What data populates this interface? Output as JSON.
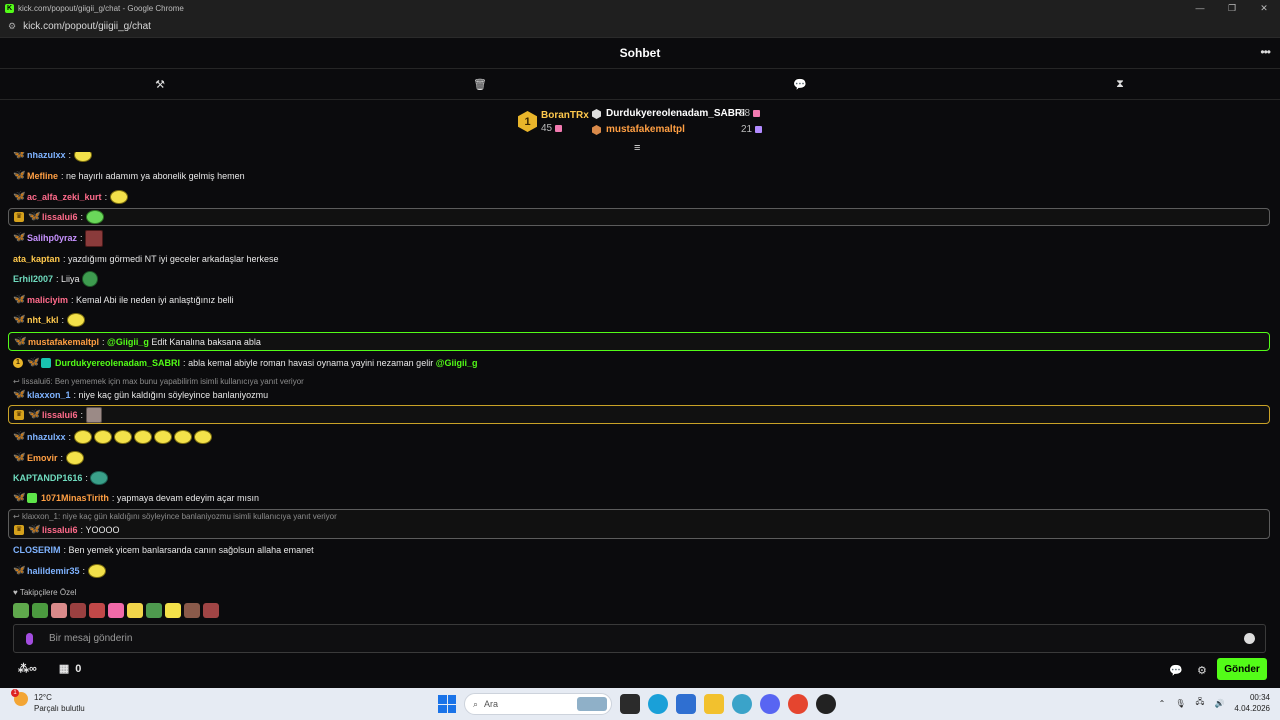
{
  "window": {
    "title": "kick.com/popout/giigii_g/chat - Google Chrome",
    "url": "kick.com/popout/giigii_g/chat"
  },
  "header": {
    "title": "Sohbet"
  },
  "leaderboard": {
    "top": {
      "rank": "1",
      "name": "BoranTRx",
      "count": "45"
    },
    "second": {
      "name": "Durdukyereolenadam_SABRI",
      "count": "28"
    },
    "third": {
      "name": "mustafakemaltpl",
      "count": "21"
    }
  },
  "messages": [
    {
      "user": "nhazulxx",
      "color": "#7fb3ff",
      "text": ""
    },
    {
      "user": "Mefline",
      "color": "#ff9f43",
      "text": "ne hayırlı adamım ya abonelik gelmiş hemen"
    },
    {
      "user": "ac_alfa_zeki_kurt",
      "color": "#ff6b8b",
      "text": ""
    },
    {
      "user": "lissalui6",
      "color": "#ff6b8b",
      "text": ""
    },
    {
      "user": "Salihp0yraz",
      "color": "#c792ff",
      "text": ""
    },
    {
      "user": "ata_kaptan",
      "color": "#ffc94d",
      "text": "yazdığımı görmedi NT iyi geceler arkadaşlar herkese"
    },
    {
      "user": "Erhil2007",
      "color": "#6fdcbf",
      "text": "Liiya"
    },
    {
      "user": "maliciyim",
      "color": "#ff6b8b",
      "text": "Kemal Abi ile neden iyi anlaştığınız belli"
    },
    {
      "user": "nht_kkl",
      "color": "#ffc94d",
      "text": ""
    },
    {
      "user": "mustafakemaltpl",
      "color": "#ff9f43",
      "mention": "@Giigii_g",
      "text": "Edit Kanalına baksana abla"
    },
    {
      "user": "Durdukyereolenadam_SABRI",
      "color": "#53fc18",
      "text": "abla kemal abiyle roman havasi oynama yayini nezaman gelir",
      "mention": "@Giigii_g"
    },
    {
      "reply": "lissalui6: Ben yememek için max bunu yapabilirim isimli kullanıcıya yanıt veriyor",
      "user": "klaxxon_1",
      "color": "#7fb3ff",
      "text": "niye kaç gün kaldığını söyleyince banlaniyozmu"
    },
    {
      "user": "lissalui6",
      "color": "#ff6b8b",
      "text": ""
    },
    {
      "user": "nhazulxx",
      "color": "#7fb3ff",
      "text": ""
    },
    {
      "user": "Emovir",
      "color": "#ff9f43",
      "text": ""
    },
    {
      "user": "KAPTANDP1616",
      "color": "#6fdcbf",
      "text": ""
    },
    {
      "user": "1071MinasTirith",
      "color": "#ff9f43",
      "text": "yapmaya devam edeyim açar mısın"
    },
    {
      "reply": "klaxxon_1: niye kaç gün kaldığını söyleyince banlaniyozmu isimli kullanıcıya yanıt veriyor",
      "user": "lissalui6",
      "color": "#ff6b8b",
      "text": "YOOOO"
    },
    {
      "user": "CLOSERIM",
      "color": "#7fb3ff",
      "text": "Ben yemek yicem banlarsanda canın sağolsun allaha emanet"
    },
    {
      "user": "halildemir35",
      "color": "#7fb3ff",
      "text": ""
    }
  ],
  "followers_label": "Takipçilere Özel",
  "input": {
    "placeholder": "Bir mesaj gönderin"
  },
  "bottom": {
    "points": "0",
    "send_label": "Gönder"
  },
  "taskbar": {
    "temp": "12°C",
    "weather": "Parçalı bulutlu",
    "weather_badge": "1",
    "search": "Ara",
    "time": "00:34",
    "date": "4.04.2026"
  }
}
